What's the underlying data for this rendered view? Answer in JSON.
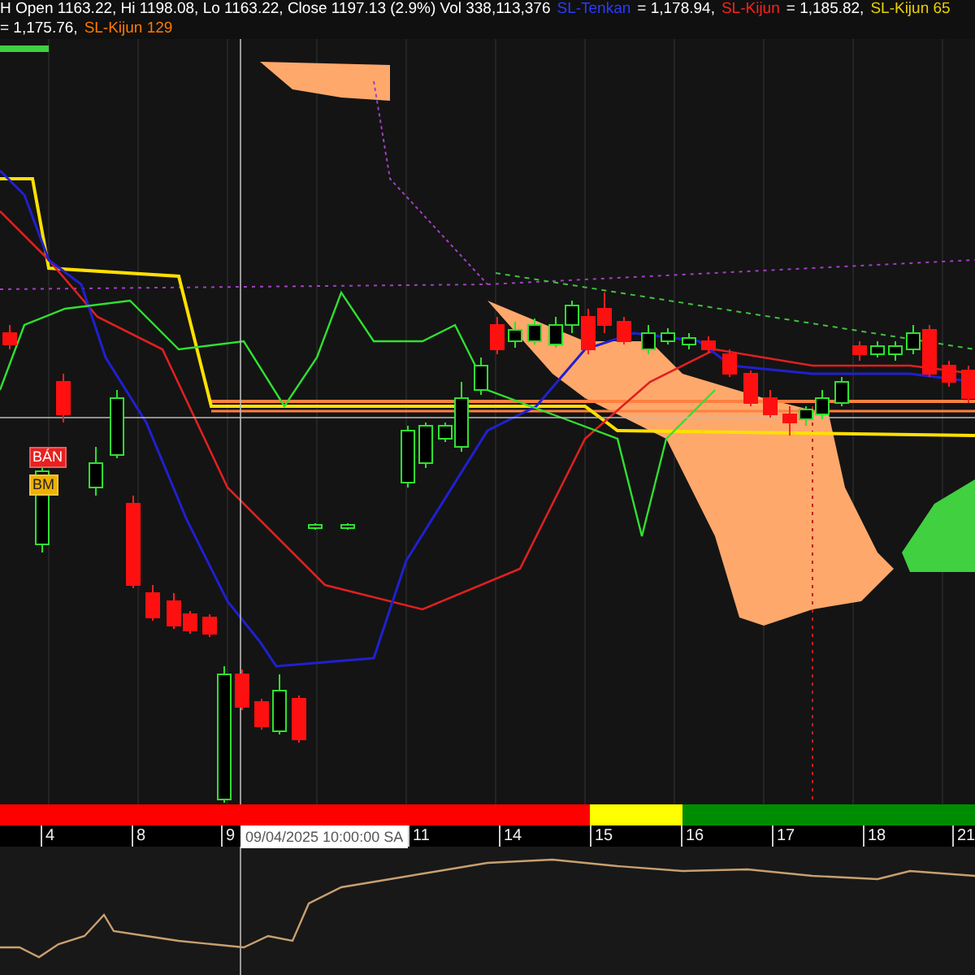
{
  "legend": {
    "ohlc": "H Open 1163.22, Hi 1198.08, Lo 1163.22, Close 1197.13 (2.9%) Vol 338,113,376",
    "items": [
      {
        "name": "SL-Tenkan",
        "value": "= 1,178.94,",
        "color": "#2a3cff"
      },
      {
        "name": "SL-Kijun",
        "value": "= 1,185.82,",
        "color": "#ff2020"
      },
      {
        "name": "SL-Kijun 65",
        "value": "= 1,175.76,",
        "color": "#e8d000"
      },
      {
        "name": "SL-Kijun 129",
        "value": "",
        "color": "#ff7a00"
      }
    ]
  },
  "signals": [
    {
      "label": "BÁN",
      "kind": "sell"
    },
    {
      "label": "BM",
      "kind": "buy"
    }
  ],
  "trend_bar": [
    {
      "color": "#ff0000"
    },
    {
      "color": "#ffff00"
    },
    {
      "color": "#008c00"
    }
  ],
  "axis": {
    "ticks": [
      "4",
      "8",
      "9",
      "11",
      "14",
      "15",
      "16",
      "17",
      "18",
      "21"
    ],
    "crosshair_label": "09/04/2025 10:00:00 SA"
  }
}
